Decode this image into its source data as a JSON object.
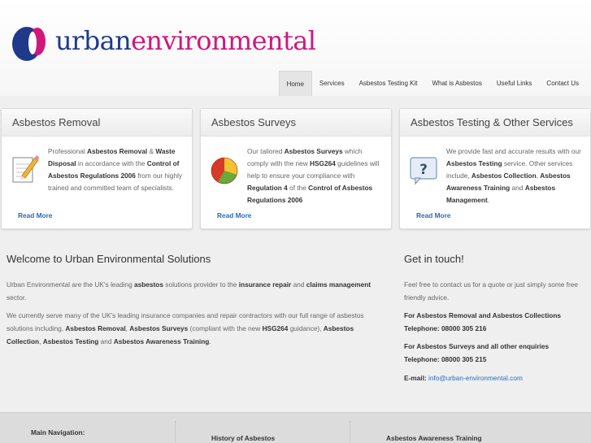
{
  "brand": {
    "name_part1": "urban",
    "name_part2": "environmental"
  },
  "nav": [
    {
      "label": "Home",
      "active": true
    },
    {
      "label": "Services"
    },
    {
      "label": "Asbestos Testing Kit"
    },
    {
      "label": "What is Asbestos"
    },
    {
      "label": "Useful Links"
    },
    {
      "label": "Contact Us"
    }
  ],
  "cards": [
    {
      "title": "Asbestos Removal",
      "icon": "notepad-pencil-icon",
      "p1": "Professional ",
      "b1": "Asbestos Removal",
      "p2": " & ",
      "b2": "Waste Disposal",
      "p3": " in accordance with the ",
      "b3": "Control of Asbestos Regulations 2006",
      "p4": " from our highly trained and committed team of specialists.",
      "read_more": "Read More"
    },
    {
      "title": "Asbestos Surveys",
      "icon": "pie-chart-icon",
      "p1": "Our tailored ",
      "b1": "Asbestos Surveys",
      "p2": " which comply with the new ",
      "b2": "HSG264",
      "p3": " guidelines will help to ensure your compliance with ",
      "b3": "Regulation 4",
      "p4": " of the ",
      "b4": "Control of Asbestos Regulations 2006",
      "read_more": "Read More"
    },
    {
      "title": "Asbestos Testing & Other Services",
      "icon": "question-bubble-icon",
      "p1": "We provide fast and accurate results with our ",
      "b1": "Asbestos Testing",
      "p2": " service. Other services include, ",
      "b2": "Asbestos Collection",
      "p3": ", ",
      "b3": "Asbestos Awareness Training",
      "p4": " and ",
      "b4": "Asbestos Management",
      "p5": ".",
      "read_more": "Read More"
    }
  ],
  "welcome": {
    "title": "Welcome to Urban Environmental Solutions",
    "p1_a": "Urban Environmental are the UK's leading ",
    "p1_b": "asbestos",
    "p1_c": " solutions provider to the ",
    "p1_d": "insurance repair",
    "p1_e": " and ",
    "p1_f": "claims management",
    "p1_g": " sector.",
    "p2_a": "We currently serve many of the UK's leading insurance companies and repair contractors with our full range of asbestos solutions including, ",
    "p2_b": "Asbestos Removal",
    "p2_c": ", ",
    "p2_d": "Asbestos Surveys",
    "p2_e": " (compliant with the new ",
    "p2_f": "HSG264",
    "p2_g": " guidance), ",
    "p2_h": "Asbestos Collection",
    "p2_i": ", ",
    "p2_j": "Asbestos Testing",
    "p2_k": " and ",
    "p2_l": "Asbestos Awareness Training",
    "p2_m": "."
  },
  "contact": {
    "title": "Get in touch!",
    "intro": "Feel free to contact us for a quote or just simply some free friendly advice.",
    "removal_label": "For Asbestos Removal and Asbestos Collections",
    "removal_phone": "Telephone: 08000 305 216",
    "surveys_label": "For Asbestos Surveys and all other enquiries",
    "surveys_phone": "Telephone: 08000 305 215",
    "email_label": "E-mail:",
    "email": "info@urban-environmental.com"
  },
  "footer": {
    "main_nav": "Main Navigation:",
    "link1": "History of Asbestos",
    "link2": "Asbestos Awareness Training"
  },
  "colors": {
    "brand_blue": "#1f3a8a",
    "brand_pink": "#d0177c",
    "link": "#2a6bb8"
  }
}
